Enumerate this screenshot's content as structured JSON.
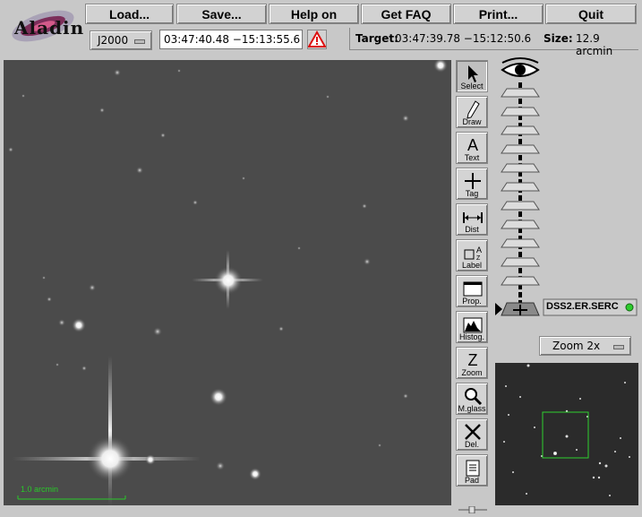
{
  "app": {
    "logo_text": "Aladin"
  },
  "menu": [
    {
      "label": "Load..."
    },
    {
      "label": "Save..."
    },
    {
      "label": "Help on"
    },
    {
      "label": "Get FAQ"
    },
    {
      "label": "Print..."
    },
    {
      "label": "Quit"
    }
  ],
  "frame": {
    "value": "J2000"
  },
  "coords": {
    "value": "03:47:40.48 −15:13:55.6"
  },
  "target": {
    "label": "Target:",
    "value": "03:47:39.78 −15:12:50.6",
    "size_label": "Size:",
    "size_value": "12.9 arcmin"
  },
  "tools": [
    {
      "label": "Select",
      "icon": "arrow-icon"
    },
    {
      "label": "Draw",
      "icon": "pencil-icon"
    },
    {
      "label": "Text",
      "icon": "text-icon"
    },
    {
      "label": "Tag",
      "icon": "plus-icon"
    },
    {
      "label": "Dist",
      "icon": "distance-icon"
    },
    {
      "label": "Label",
      "icon": "label-icon"
    },
    {
      "label": "Prop.",
      "icon": "properties-icon"
    },
    {
      "label": "Histog.",
      "icon": "histogram-icon"
    },
    {
      "label": "Zoom",
      "icon": "zoom-icon"
    },
    {
      "label": "M.glass",
      "icon": "magnifier-icon"
    },
    {
      "label": "Del.",
      "icon": "delete-icon"
    },
    {
      "label": "Pad",
      "icon": "pad-icon"
    }
  ],
  "plane": {
    "name": "DSS2.ER.SERC"
  },
  "zoom": {
    "value": "Zoom 2x"
  },
  "scale": {
    "label": "1.0 arcmin"
  },
  "colors": {
    "scale": "#29c929",
    "thumb_box": "#2fd02f",
    "plane_dot": "#2ecc2e",
    "bg": "#c8c8c8"
  }
}
